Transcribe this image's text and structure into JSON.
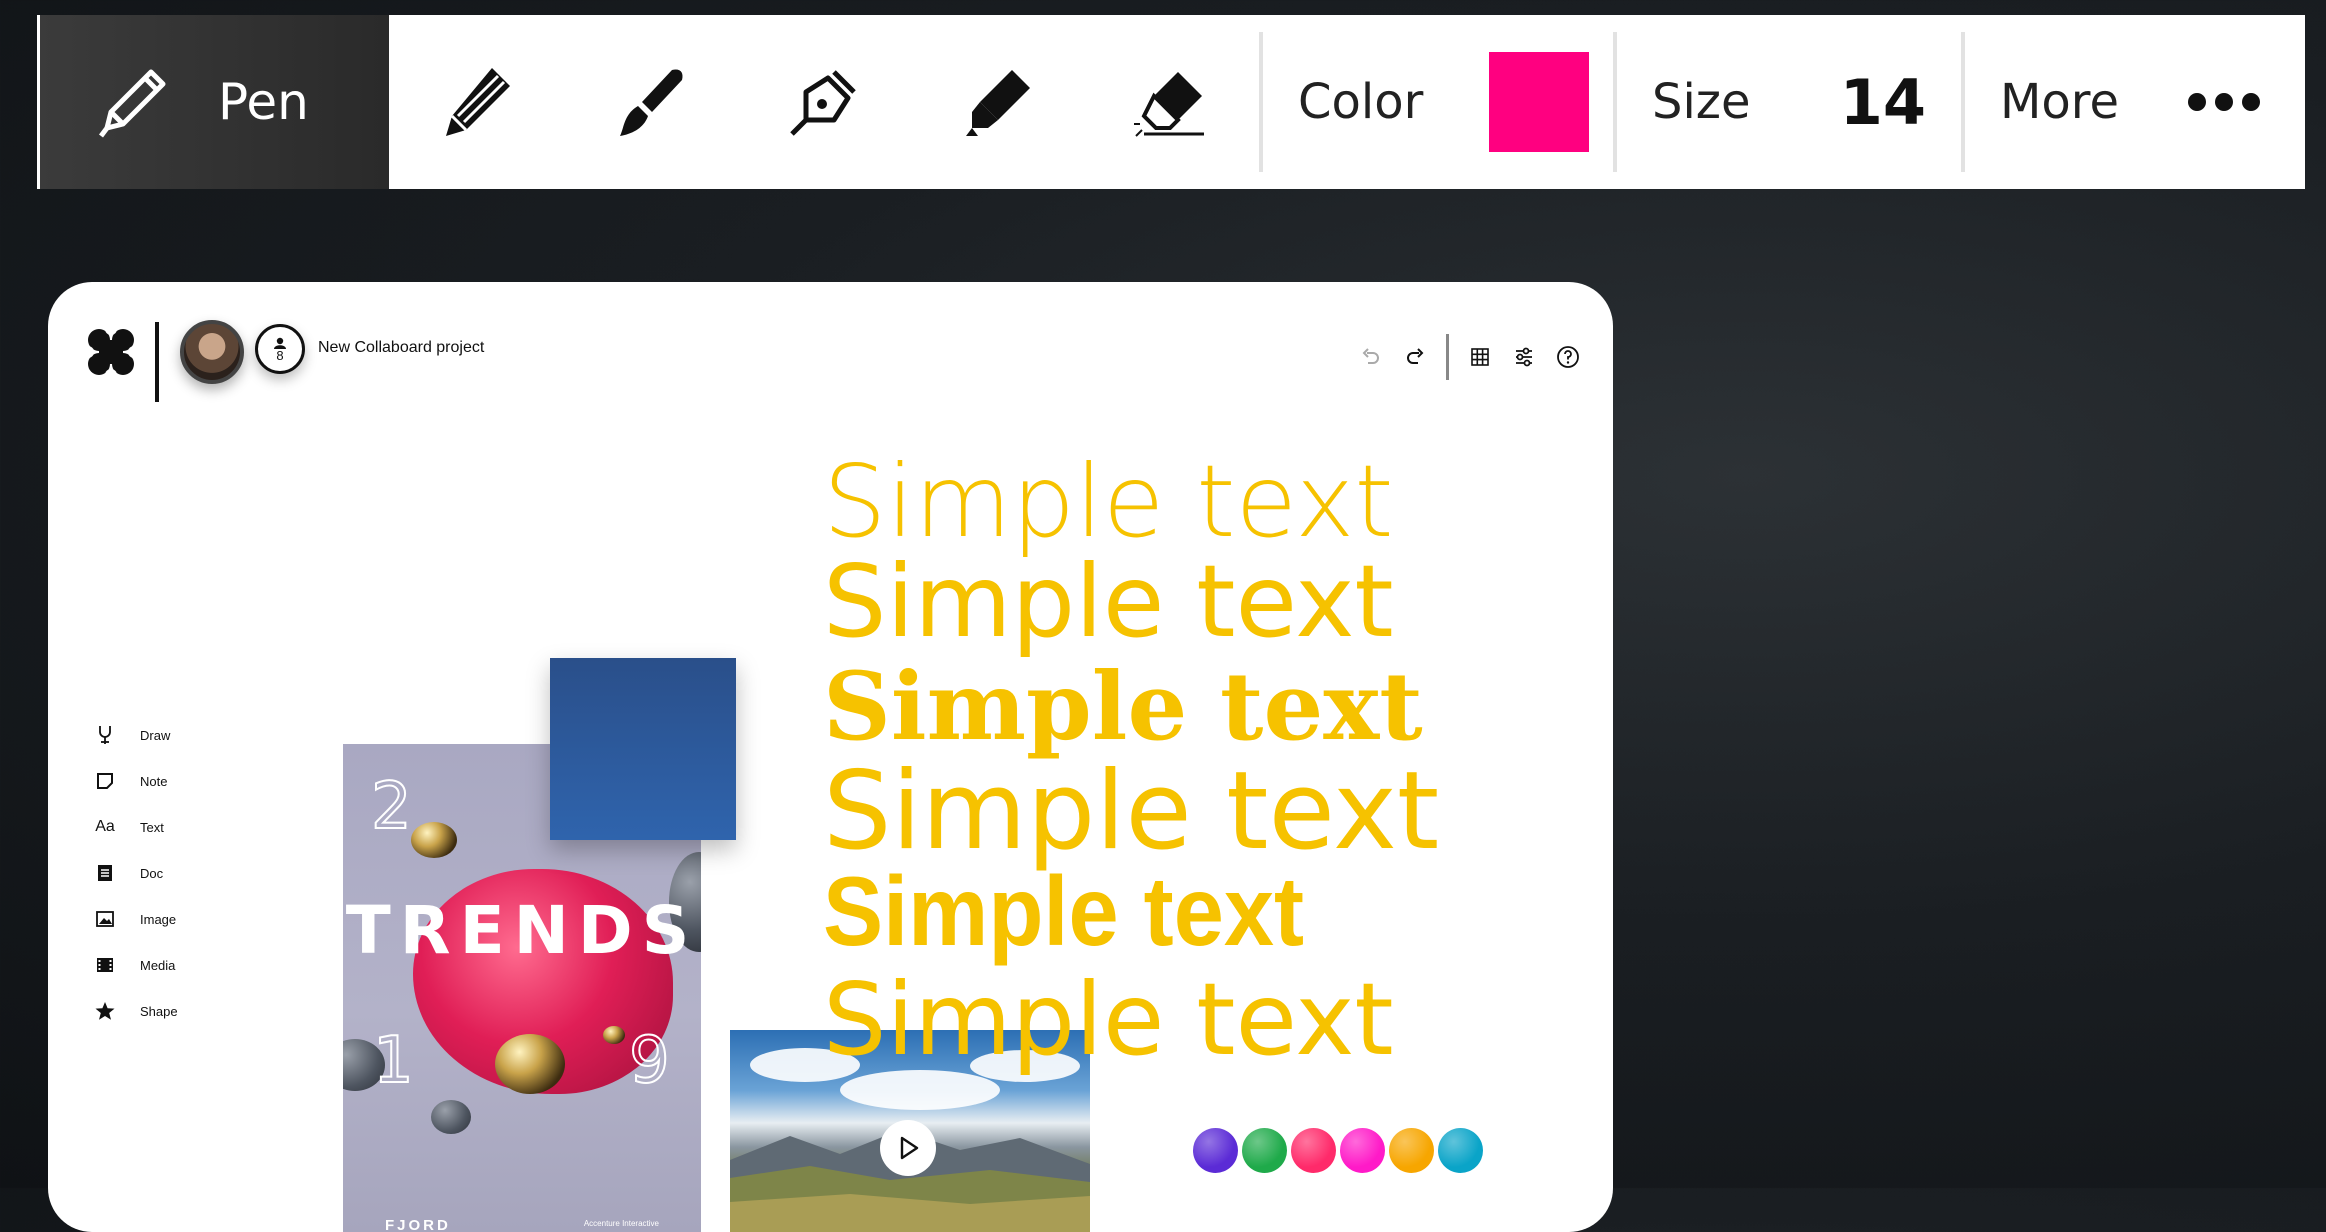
{
  "toolbar": {
    "mode_label": "Pen",
    "tools": [
      {
        "name": "pencil-icon"
      },
      {
        "name": "brush-icon"
      },
      {
        "name": "fountain-pen-icon"
      },
      {
        "name": "highlighter-icon"
      },
      {
        "name": "eraser-icon"
      }
    ],
    "color_label": "Color",
    "color_value": "#ff0080",
    "size_label": "Size",
    "size_value": "14",
    "more_label": "More"
  },
  "board": {
    "project_name": "New Collaboard project",
    "user_count": "8",
    "side_tools": [
      {
        "label": "Draw",
        "icon": "draw-icon"
      },
      {
        "label": "Note",
        "icon": "note-icon"
      },
      {
        "label": "Text",
        "icon": "text-icon"
      },
      {
        "label": "Doc",
        "icon": "doc-icon"
      },
      {
        "label": "Image",
        "icon": "image-icon"
      },
      {
        "label": "Media",
        "icon": "media-icon"
      },
      {
        "label": "Shape",
        "icon": "shape-icon"
      }
    ],
    "poster": {
      "title": "TRENDS",
      "num_top": "2",
      "num_bl": "1",
      "num_br": "9",
      "footer": "FJORD",
      "footer_small": "Accenture Interactive"
    },
    "text_samples": [
      "Simple text",
      "Simple text",
      "Simple text",
      "Simple text",
      "Simple text",
      "Simple text"
    ],
    "palette": [
      "#5b2bd6",
      "#1faa4a",
      "#ff2a6a",
      "#ff1ac8",
      "#f7a600",
      "#0aa4c8"
    ]
  }
}
